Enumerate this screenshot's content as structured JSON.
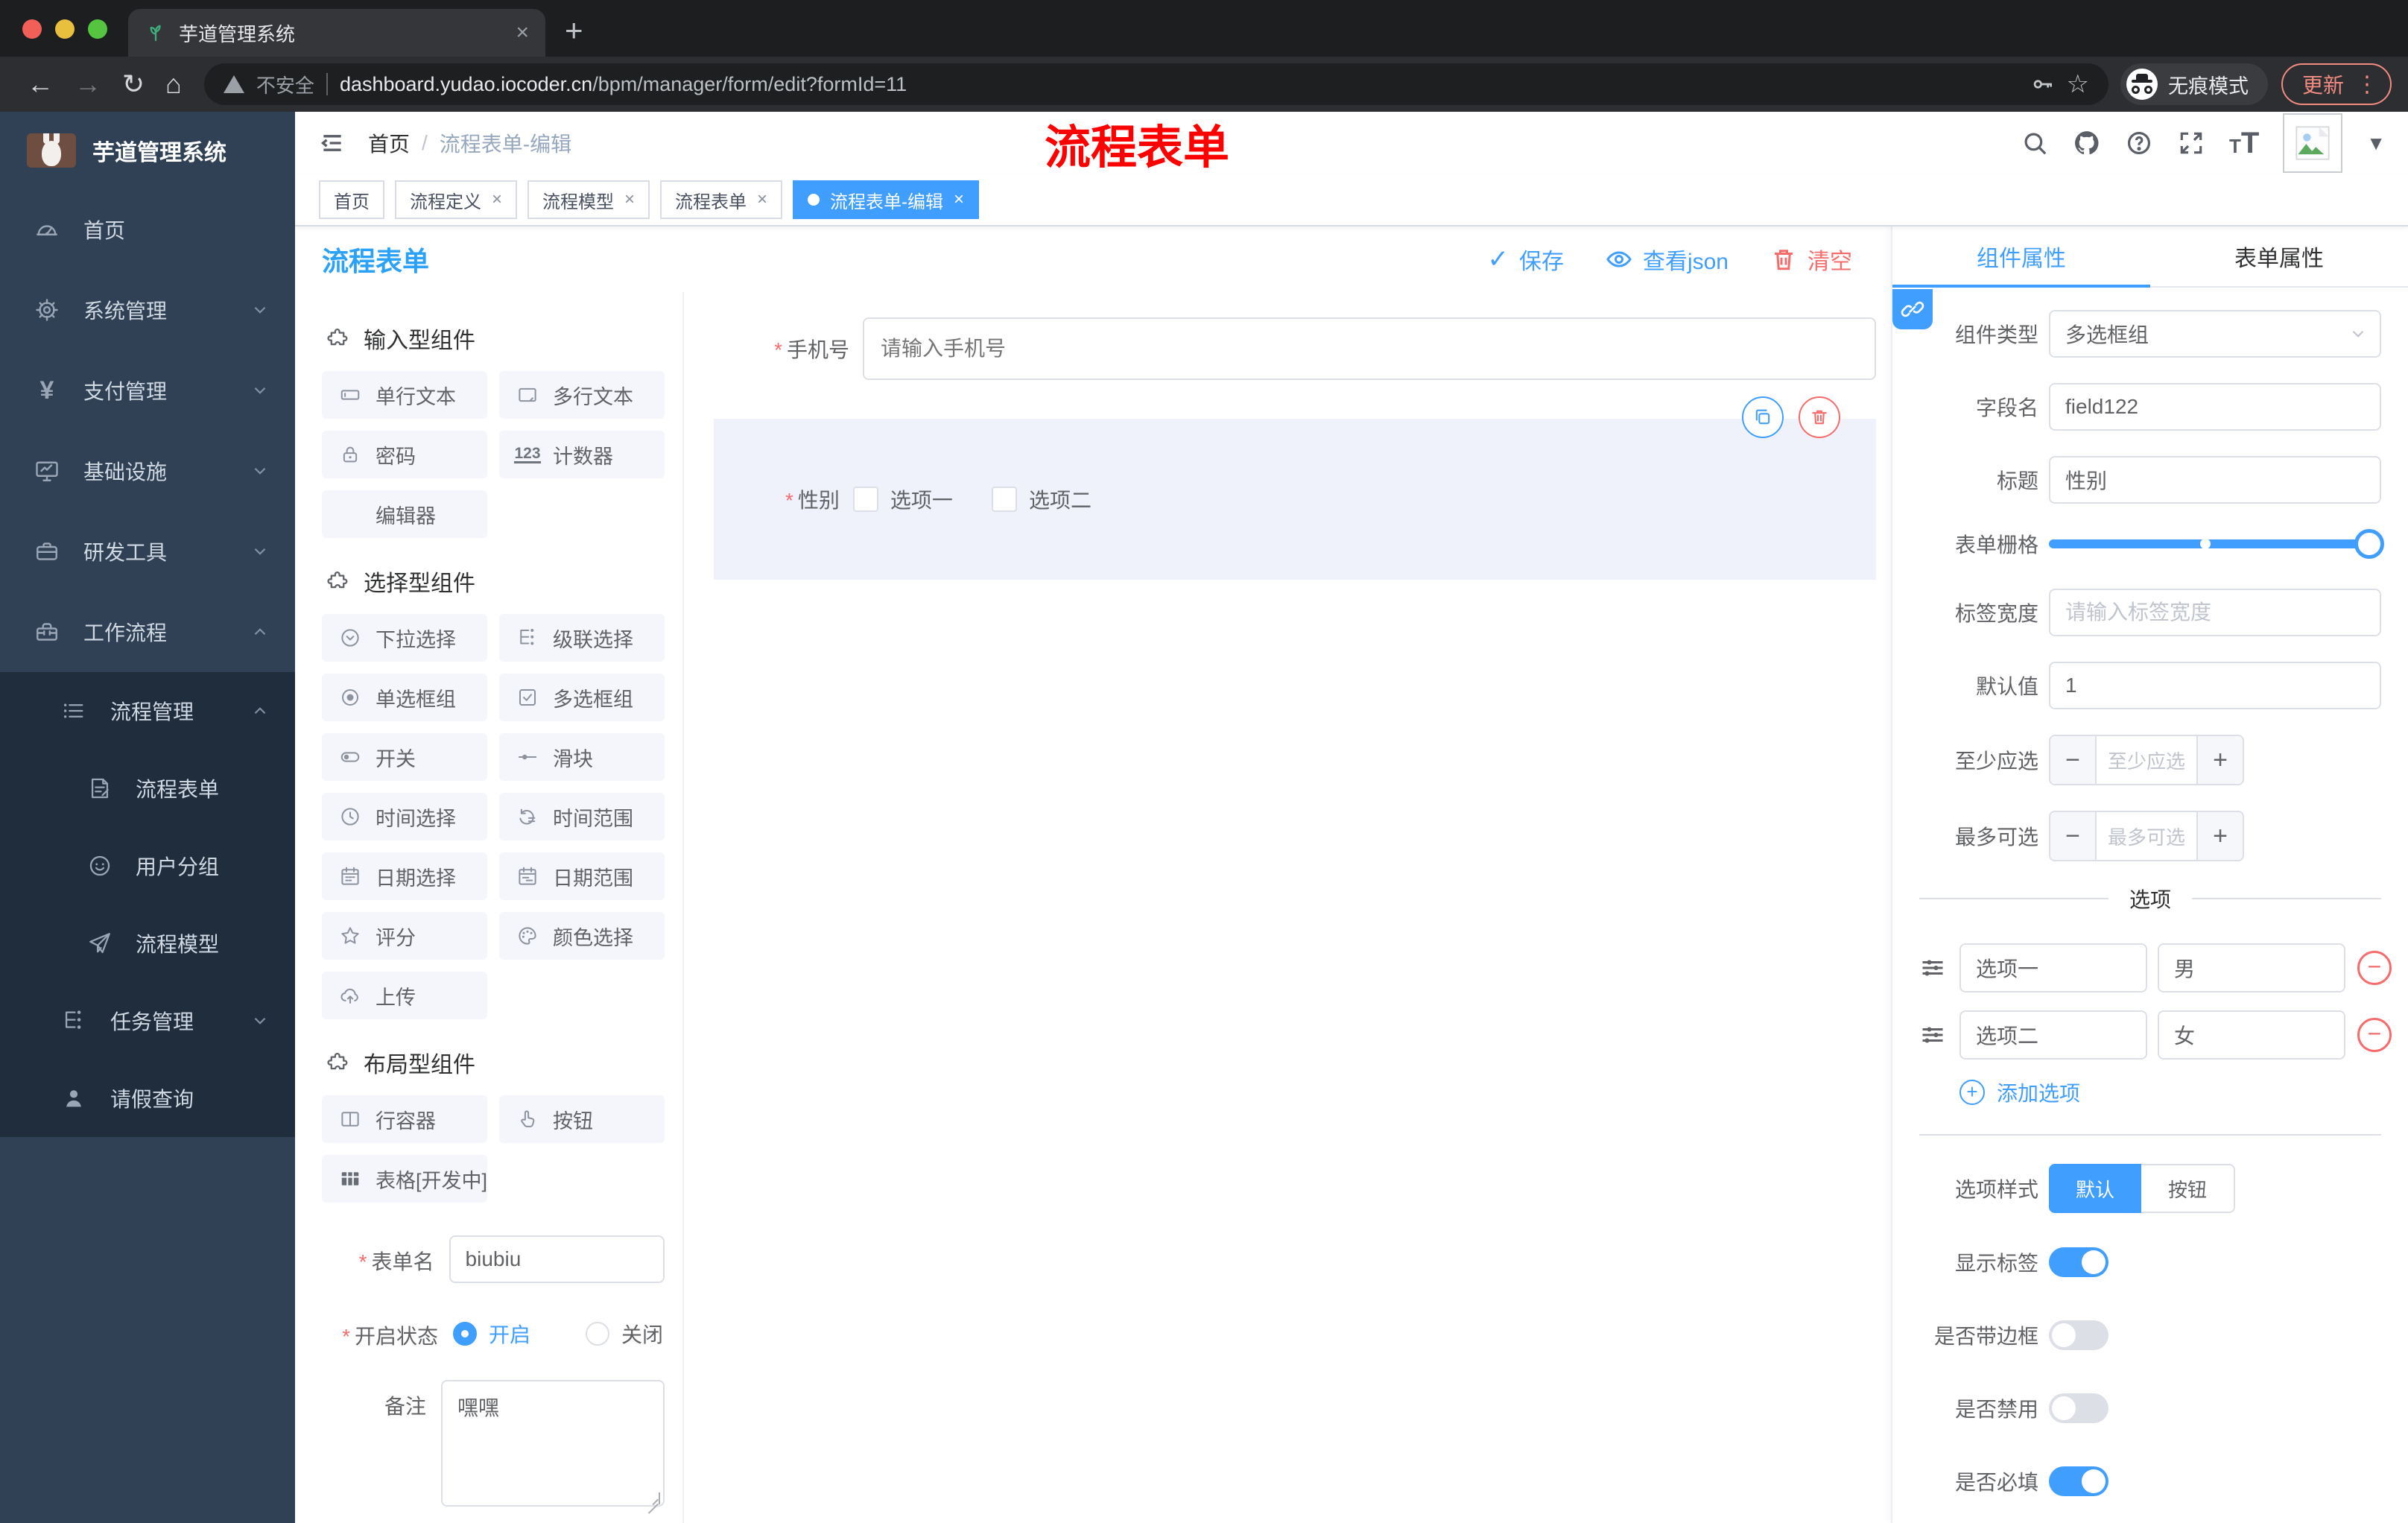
{
  "browser": {
    "tab_title": "芋道管理系统",
    "security_label": "不安全",
    "url_domain": "dashboard.yudao.iocoder.cn",
    "url_path": "/bpm/manager/form/edit?formId=11",
    "incognito_label": "无痕模式",
    "update_label": "更新"
  },
  "sidebar": {
    "logo_title": "芋道管理系统",
    "menu": [
      {
        "label": "首页"
      },
      {
        "label": "系统管理"
      },
      {
        "label": "支付管理"
      },
      {
        "label": "基础设施"
      },
      {
        "label": "研发工具"
      },
      {
        "label": "工作流程"
      },
      {
        "label": "流程管理"
      },
      {
        "label": "流程表单"
      },
      {
        "label": "用户分组"
      },
      {
        "label": "流程模型"
      },
      {
        "label": "任务管理"
      },
      {
        "label": "请假查询"
      }
    ]
  },
  "appbar": {
    "breadcrumb_home": "首页",
    "breadcrumb_separator": "/",
    "breadcrumb_current": "流程表单-编辑",
    "annotation": "流程表单"
  },
  "tags": [
    {
      "label": "首页",
      "active": false,
      "closable": false
    },
    {
      "label": "流程定义",
      "active": false,
      "closable": true
    },
    {
      "label": "流程模型",
      "active": false,
      "closable": true
    },
    {
      "label": "流程表单",
      "active": false,
      "closable": true
    },
    {
      "label": "流程表单-编辑",
      "active": true,
      "closable": true
    }
  ],
  "workspace": {
    "title": "流程表单",
    "actions": {
      "save": "保存",
      "view_json": "查看json",
      "clear": "清空"
    }
  },
  "components": {
    "sections": [
      {
        "title": "输入型组件",
        "items": [
          {
            "label": "单行文本"
          },
          {
            "label": "多行文本"
          },
          {
            "label": "密码"
          },
          {
            "label": "计数器"
          },
          {
            "label": "编辑器"
          }
        ]
      },
      {
        "title": "选择型组件",
        "items": [
          {
            "label": "下拉选择"
          },
          {
            "label": "级联选择"
          },
          {
            "label": "单选框组"
          },
          {
            "label": "多选框组"
          },
          {
            "label": "开关"
          },
          {
            "label": "滑块"
          },
          {
            "label": "时间选择"
          },
          {
            "label": "时间范围"
          },
          {
            "label": "日期选择"
          },
          {
            "label": "日期范围"
          },
          {
            "label": "评分"
          },
          {
            "label": "颜色选择"
          },
          {
            "label": "上传"
          }
        ]
      },
      {
        "title": "布局型组件",
        "items": [
          {
            "label": "行容器"
          },
          {
            "label": "按钮"
          },
          {
            "label": "表格[开发中]"
          }
        ]
      }
    ],
    "form": {
      "name_label": "表单名",
      "name_value": "biubiu",
      "status_label": "开启状态",
      "status_on": "开启",
      "status_off": "关闭",
      "status_selected": "开启",
      "remark_label": "备注",
      "remark_value": "嘿嘿"
    }
  },
  "canvas": {
    "phone": {
      "label": "手机号",
      "required": true,
      "placeholder": "请输入手机号"
    },
    "gender": {
      "label": "性别",
      "required": true,
      "option1": "选项一",
      "option2": "选项二",
      "selected": true
    }
  },
  "props": {
    "tabs": {
      "component": "组件属性",
      "form": "表单属性",
      "active": "组件属性"
    },
    "component_type_label": "组件类型",
    "component_type_value": "多选框组",
    "field_name_label": "字段名",
    "field_name_value": "field122",
    "title_label": "标题",
    "title_value": "性别",
    "grid_label": "表单栅格",
    "grid_state": {
      "fill_percent": 100,
      "stop_percent": 47
    },
    "label_width_label": "标签宽度",
    "label_width_placeholder": "请输入标签宽度",
    "default_label": "默认值",
    "default_value": "1",
    "min_label": "至少应选",
    "min_placeholder": "至少应选",
    "max_label": "最多可选",
    "max_placeholder": "最多可选",
    "options_title": "选项",
    "option_rows": [
      {
        "label": "选项一",
        "value": "男"
      },
      {
        "label": "选项二",
        "value": "女"
      }
    ],
    "add_option_label": "添加选项",
    "style_label": "选项样式",
    "style_default": "默认",
    "style_button": "按钮",
    "style_active": "默认",
    "switches": [
      {
        "label": "显示标签",
        "on": true
      },
      {
        "label": "是否带边框",
        "on": false
      },
      {
        "label": "是否禁用",
        "on": false
      },
      {
        "label": "是否必填",
        "on": true
      }
    ]
  },
  "colors": {
    "primary": "#409eff",
    "danger": "#f56c6c",
    "page_title_blue": "#2ba2f7",
    "annotation_red": "#ff0000",
    "sidebar_bg": "#304156",
    "submenu_bg": "#1f2d3d",
    "selected_row_bg": "#f0f2fb",
    "pill_bg": "#f4f6fc"
  }
}
